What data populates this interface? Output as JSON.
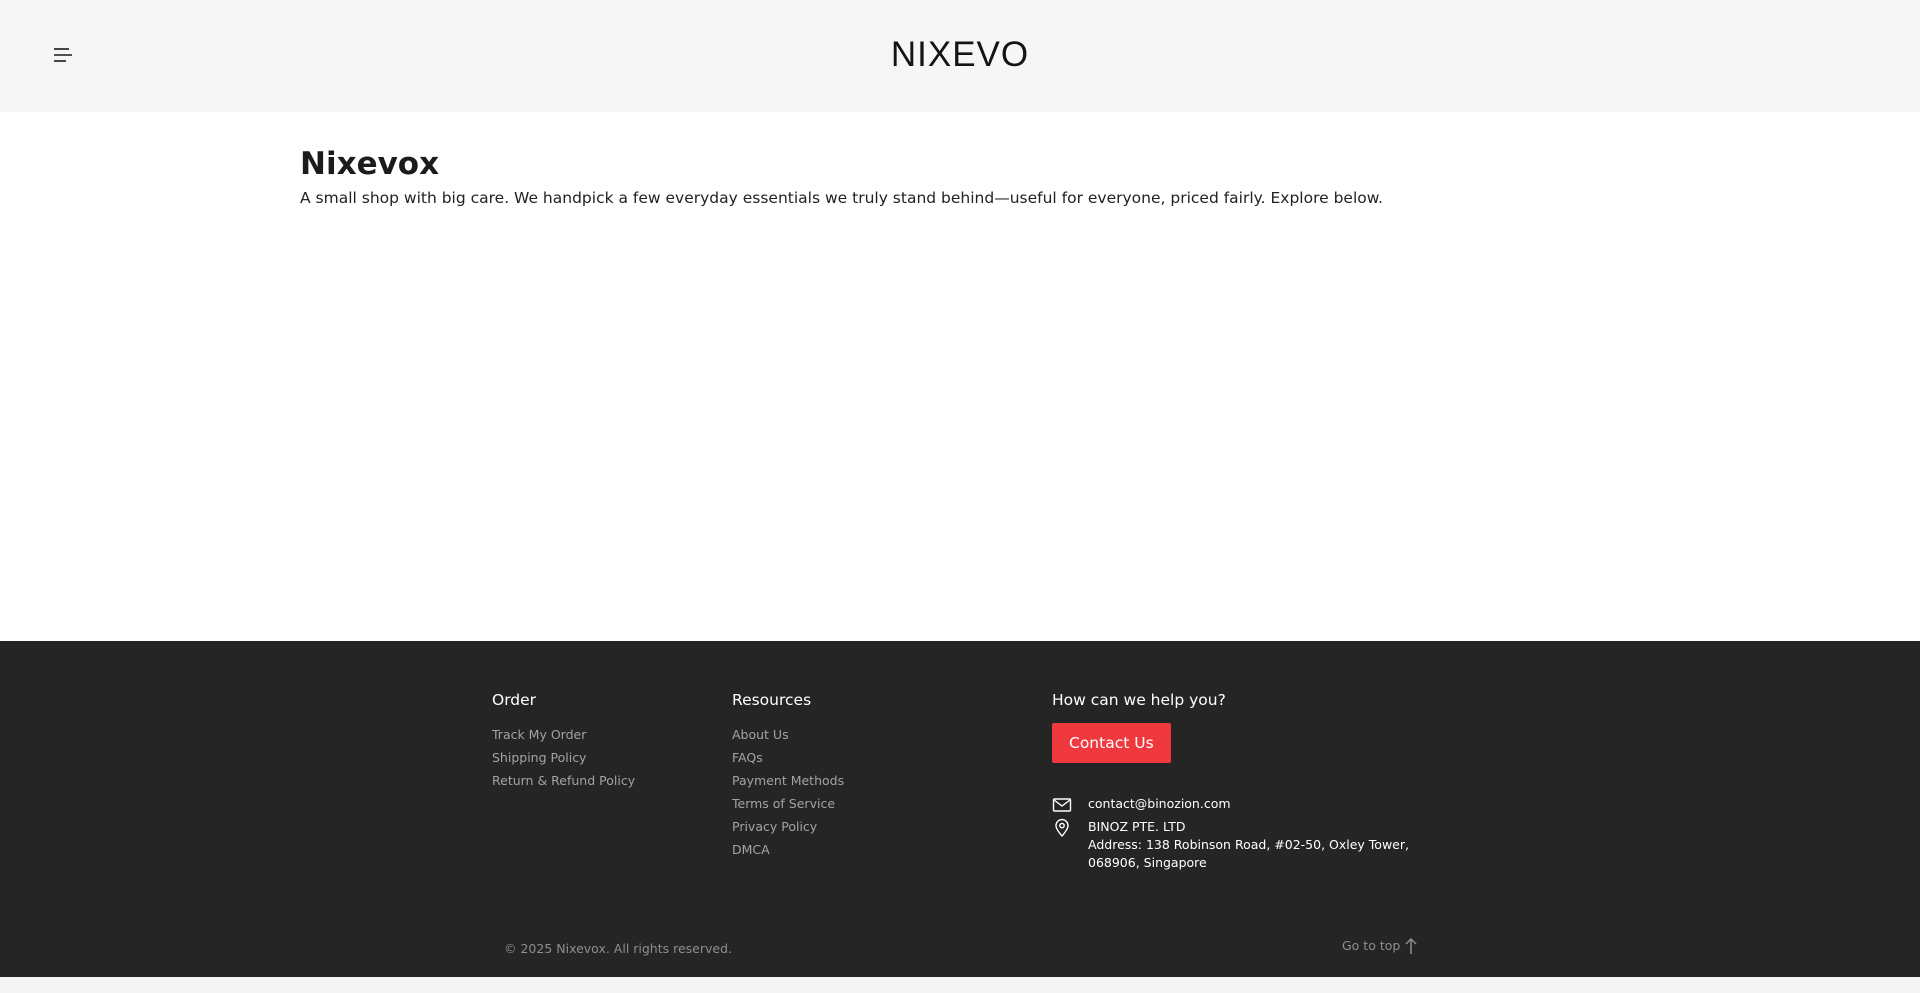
{
  "header": {
    "logo_text": "NIXEVO",
    "menu_icon": "hamburger-menu-icon"
  },
  "main": {
    "title": "Nixevox",
    "description": "A small shop with big care. We handpick a few everyday essentials we truly stand behind—useful for everyone, priced fairly. Explore below."
  },
  "footer": {
    "order": {
      "title": "Order",
      "links": [
        "Track My Order",
        "Shipping Policy",
        "Return & Refund Policy"
      ]
    },
    "resources": {
      "title": "Resources",
      "links": [
        "About Us",
        "FAQs",
        "Payment Methods",
        "Terms of Service",
        "Privacy Policy",
        "DMCA"
      ]
    },
    "help": {
      "title": "How can we help you?",
      "contact_button": "Contact Us",
      "email": "contact@binozion.com",
      "company": "BINOZ PTE. LTD",
      "address_line1": "Address: 138 Robinson Road, #02-50, Oxley Tower,",
      "address_line2": "068906, Singapore",
      "email_icon": "mail-icon",
      "location_icon": "map-pin-icon"
    },
    "copyright": "© 2025 Nixevox. All rights reserved.",
    "go_to_top": "Go to top",
    "go_to_top_icon": "arrow-up-icon"
  },
  "colors": {
    "header_bg": "#f6f6f6",
    "footer_bg": "#252525",
    "accent_button": "#f0393e",
    "link_muted": "#a3a3a3"
  }
}
